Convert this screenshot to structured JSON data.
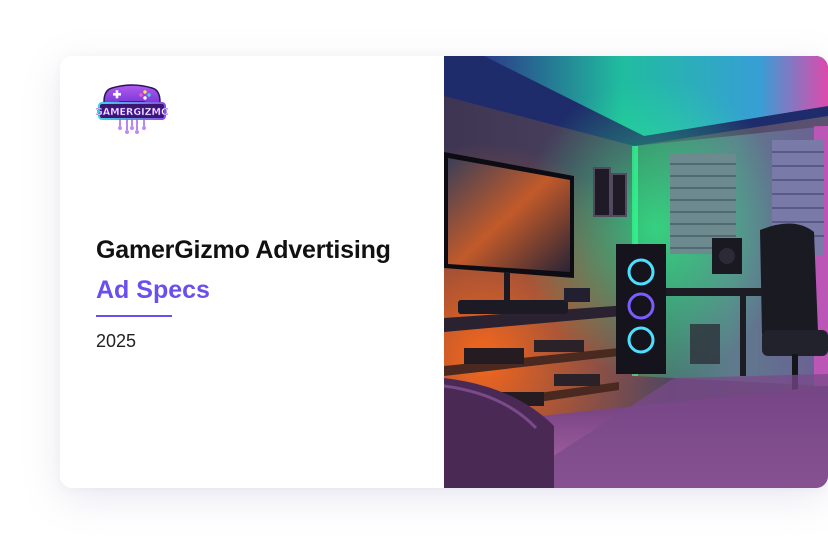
{
  "logo": {
    "icon": "gamepad-logo-icon",
    "text": "GAMERGIZMO"
  },
  "header": {
    "title": "GamerGizmo Advertising",
    "subtitle": "Ad Specs",
    "year": "2025"
  },
  "colors": {
    "accent": "#6a4ff0",
    "title_text": "#111111",
    "logo_purple": "#7a3fd6",
    "logo_cyan": "#2fd3e6"
  },
  "hero_image": {
    "icon": "gaming-room-photo"
  }
}
